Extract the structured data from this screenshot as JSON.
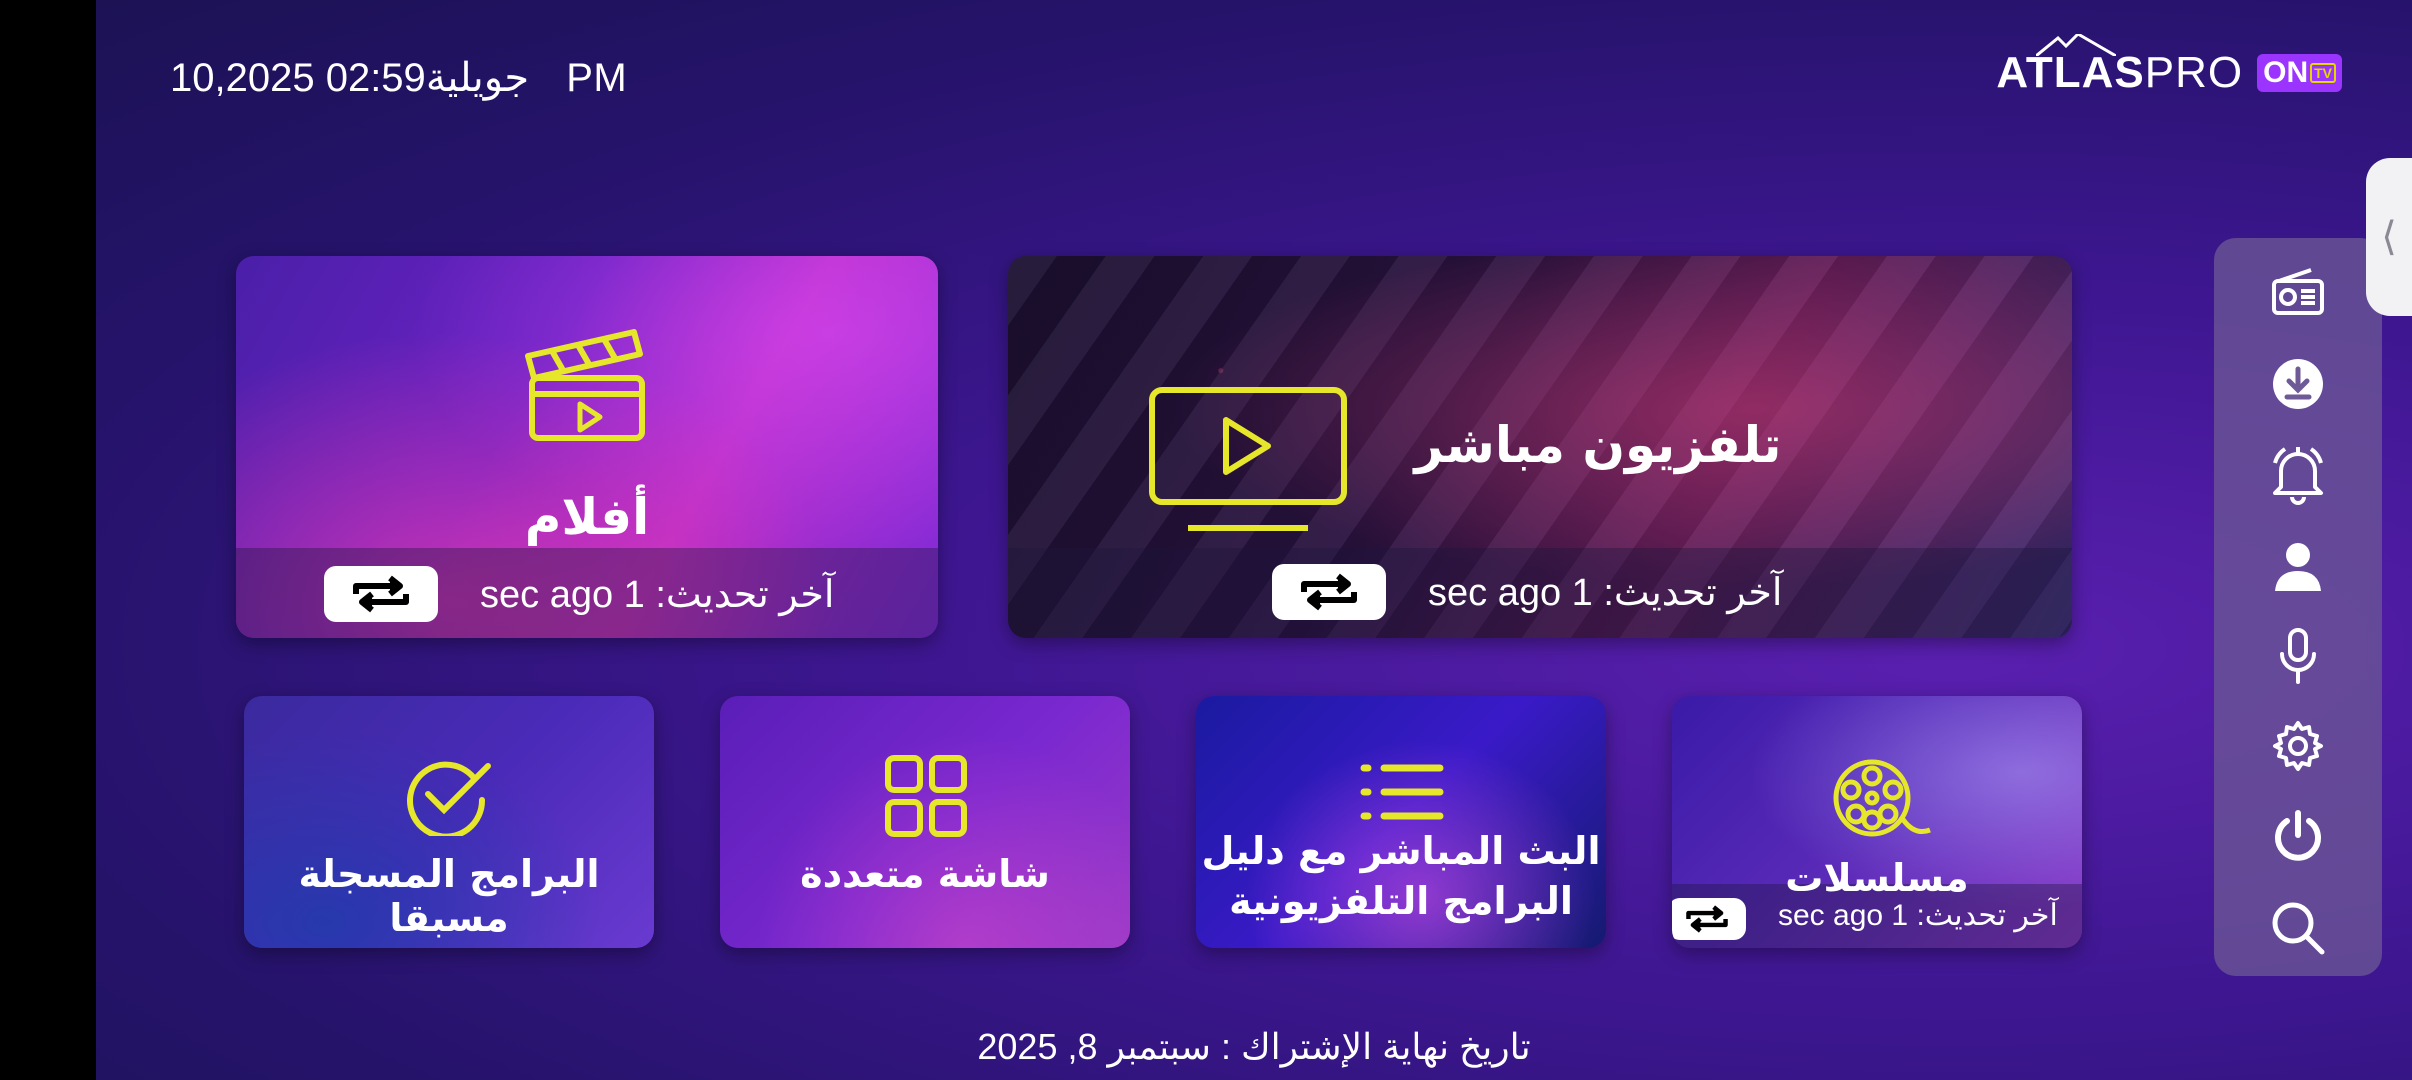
{
  "header": {
    "time": "02:59 PM",
    "date": "10,2025 جويلية",
    "logo_atlas": "ATLAS",
    "logo_pro": "PRO",
    "logo_on": "ON",
    "logo_tv": "TV"
  },
  "cards": {
    "movies": {
      "title": "أفلام",
      "status": "آخر تحديث: 1 sec ago"
    },
    "live_tv": {
      "title": "تلفزيون مباشر",
      "status": "آخر تحديث: 1 sec ago"
    },
    "recordings": {
      "title": "البرامج المسجلة مسبقا"
    },
    "multiscreen": {
      "title": "شاشة متعددة"
    },
    "epg": {
      "title_line1": "البث المباشر مع دليل",
      "title_line2": "البرامج التلفزيونية"
    },
    "series": {
      "title": "مسلسلات",
      "status": "آخر تحديث: 1 sec ago"
    }
  },
  "sidebar": {
    "items": [
      "radio-icon",
      "download-icon",
      "bell-icon",
      "user-icon",
      "microphone-icon",
      "settings-icon",
      "power-icon",
      "search-icon"
    ]
  },
  "handle_glyph": "⟨",
  "footer": {
    "subscription": "تاريخ نهاية الإشتراك : سبتمبر 8, 2025"
  },
  "colors": {
    "accent_yellow": "#e6e62a",
    "sidebar_bg": "#6e5a96",
    "background": "#3d1690"
  }
}
